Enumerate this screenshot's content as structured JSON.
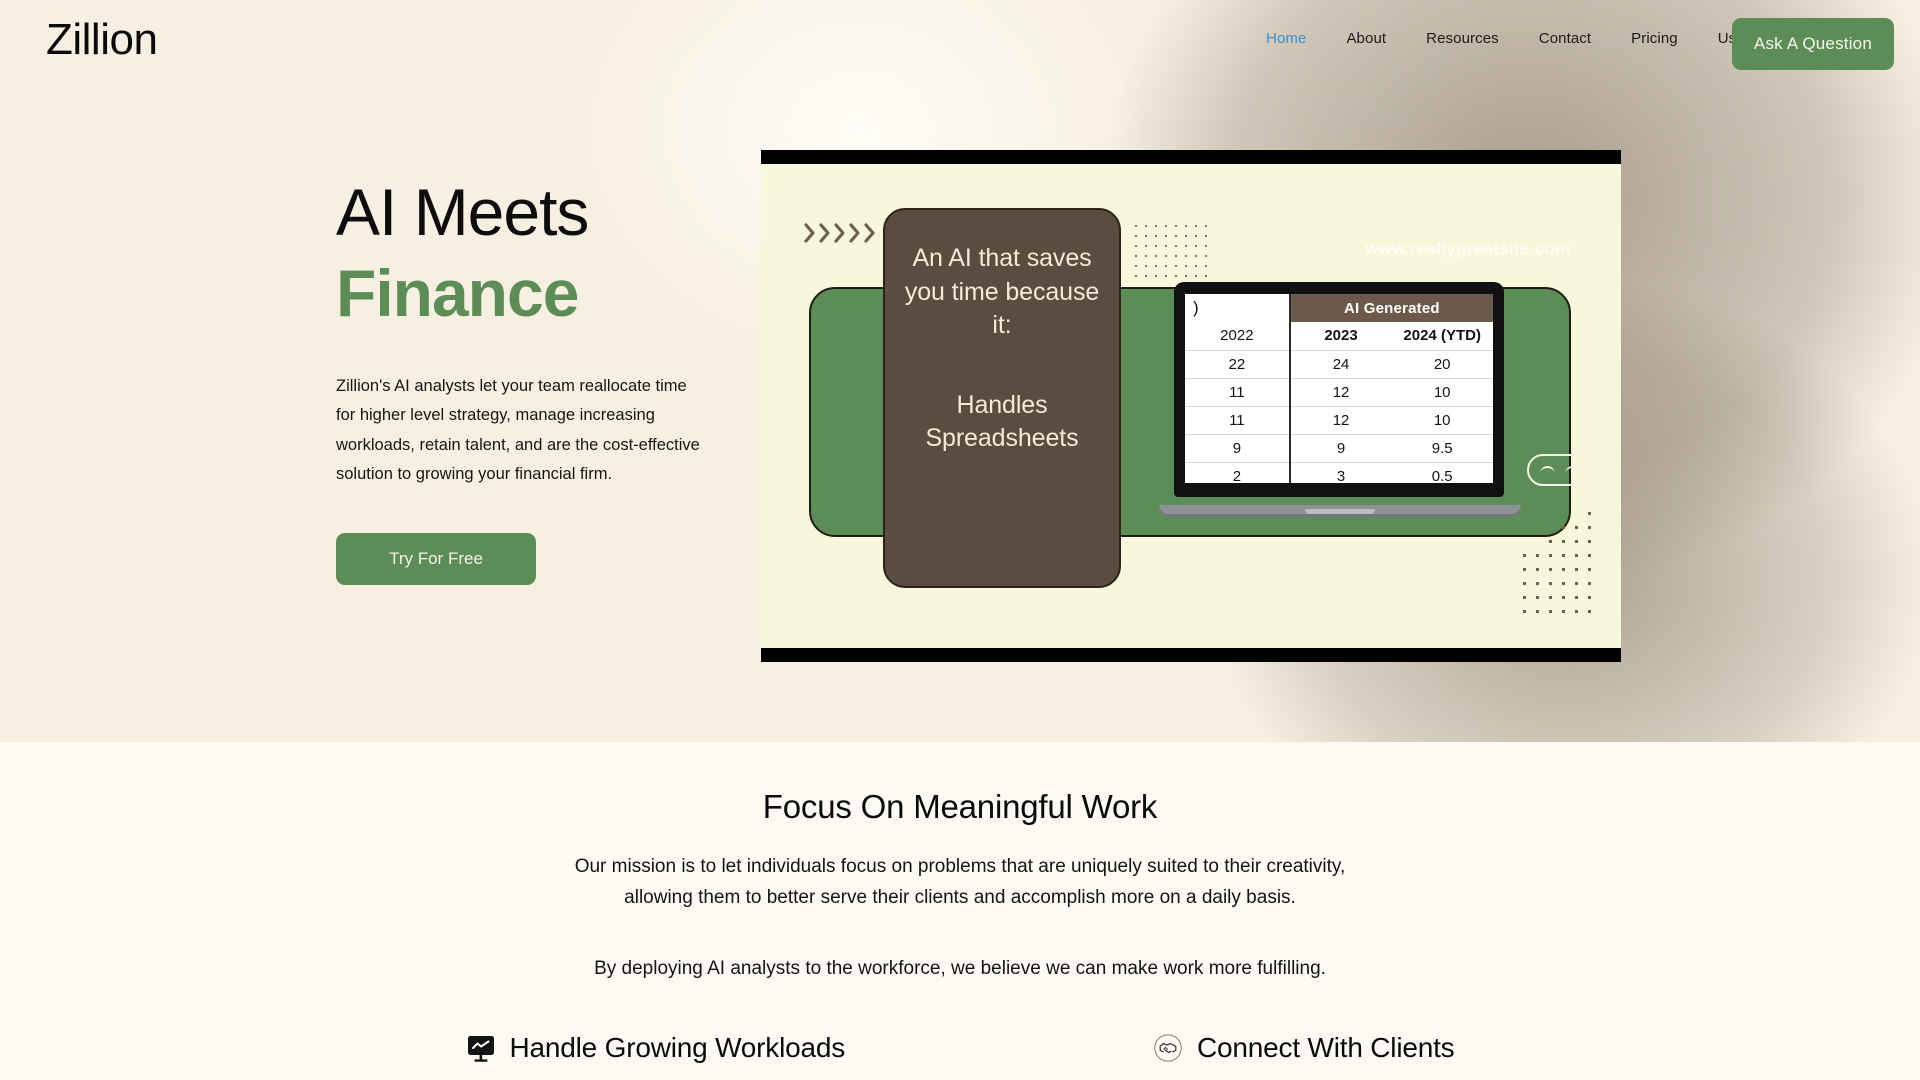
{
  "brand": {
    "name": "Zillion"
  },
  "nav": {
    "links": [
      {
        "label": "Home",
        "active": true
      },
      {
        "label": "About",
        "active": false
      },
      {
        "label": "Resources",
        "active": false
      },
      {
        "label": "Contact",
        "active": false
      },
      {
        "label": "Pricing",
        "active": false
      },
      {
        "label": "Use Cases",
        "active": false
      }
    ],
    "cta_label": "Ask A Question"
  },
  "hero": {
    "title_line1": "AI Meets",
    "title_line2": "Finance",
    "paragraph": "Zillion's AI analysts let your team reallocate time for higher level strategy, manage increasing workloads, retain talent, and are the cost-effective solution to growing your financial firm.",
    "cta_label": "Try For Free",
    "watermark": "www.reallygreatsite.com",
    "chevron_count": 5,
    "callout": {
      "line1": "An AI that saves you time because it:",
      "line2": "Handles Spreadsheets"
    }
  },
  "chart_data": {
    "type": "table",
    "title": "AI Generated",
    "merged_header": "AI Generated",
    "partial_left_header": ")",
    "columns": [
      "2022",
      "2023",
      "2024 (YTD)"
    ],
    "rows": [
      [
        "22",
        "24",
        "20"
      ],
      [
        "11",
        "12",
        "10"
      ],
      [
        "11",
        "12",
        "10"
      ],
      [
        "9",
        "9",
        "9.5"
      ],
      [
        "2",
        "3",
        "0.5"
      ]
    ]
  },
  "mission": {
    "title": "Focus On Meaningful Work",
    "body_line1": "Our mission is to let individuals focus on problems that are uniquely suited to their creativity,",
    "body_line2": "allowing them to better serve their clients and accomplish more on a daily basis.",
    "note": "By deploying AI analysts to the workforce, we believe we can make work more fulfilling."
  },
  "features": [
    {
      "label": "Handle Growing Workloads",
      "icon": "monitor-chart-icon"
    },
    {
      "label": "Connect With Clients",
      "icon": "handshake-icon"
    }
  ],
  "colors": {
    "accent_green": "#5d8d56",
    "brown_card": "#5a4c3e",
    "hero_bg": "#f7f0e2",
    "card_canvas": "#f7f7dc",
    "active_link": "#3b8fd4"
  }
}
